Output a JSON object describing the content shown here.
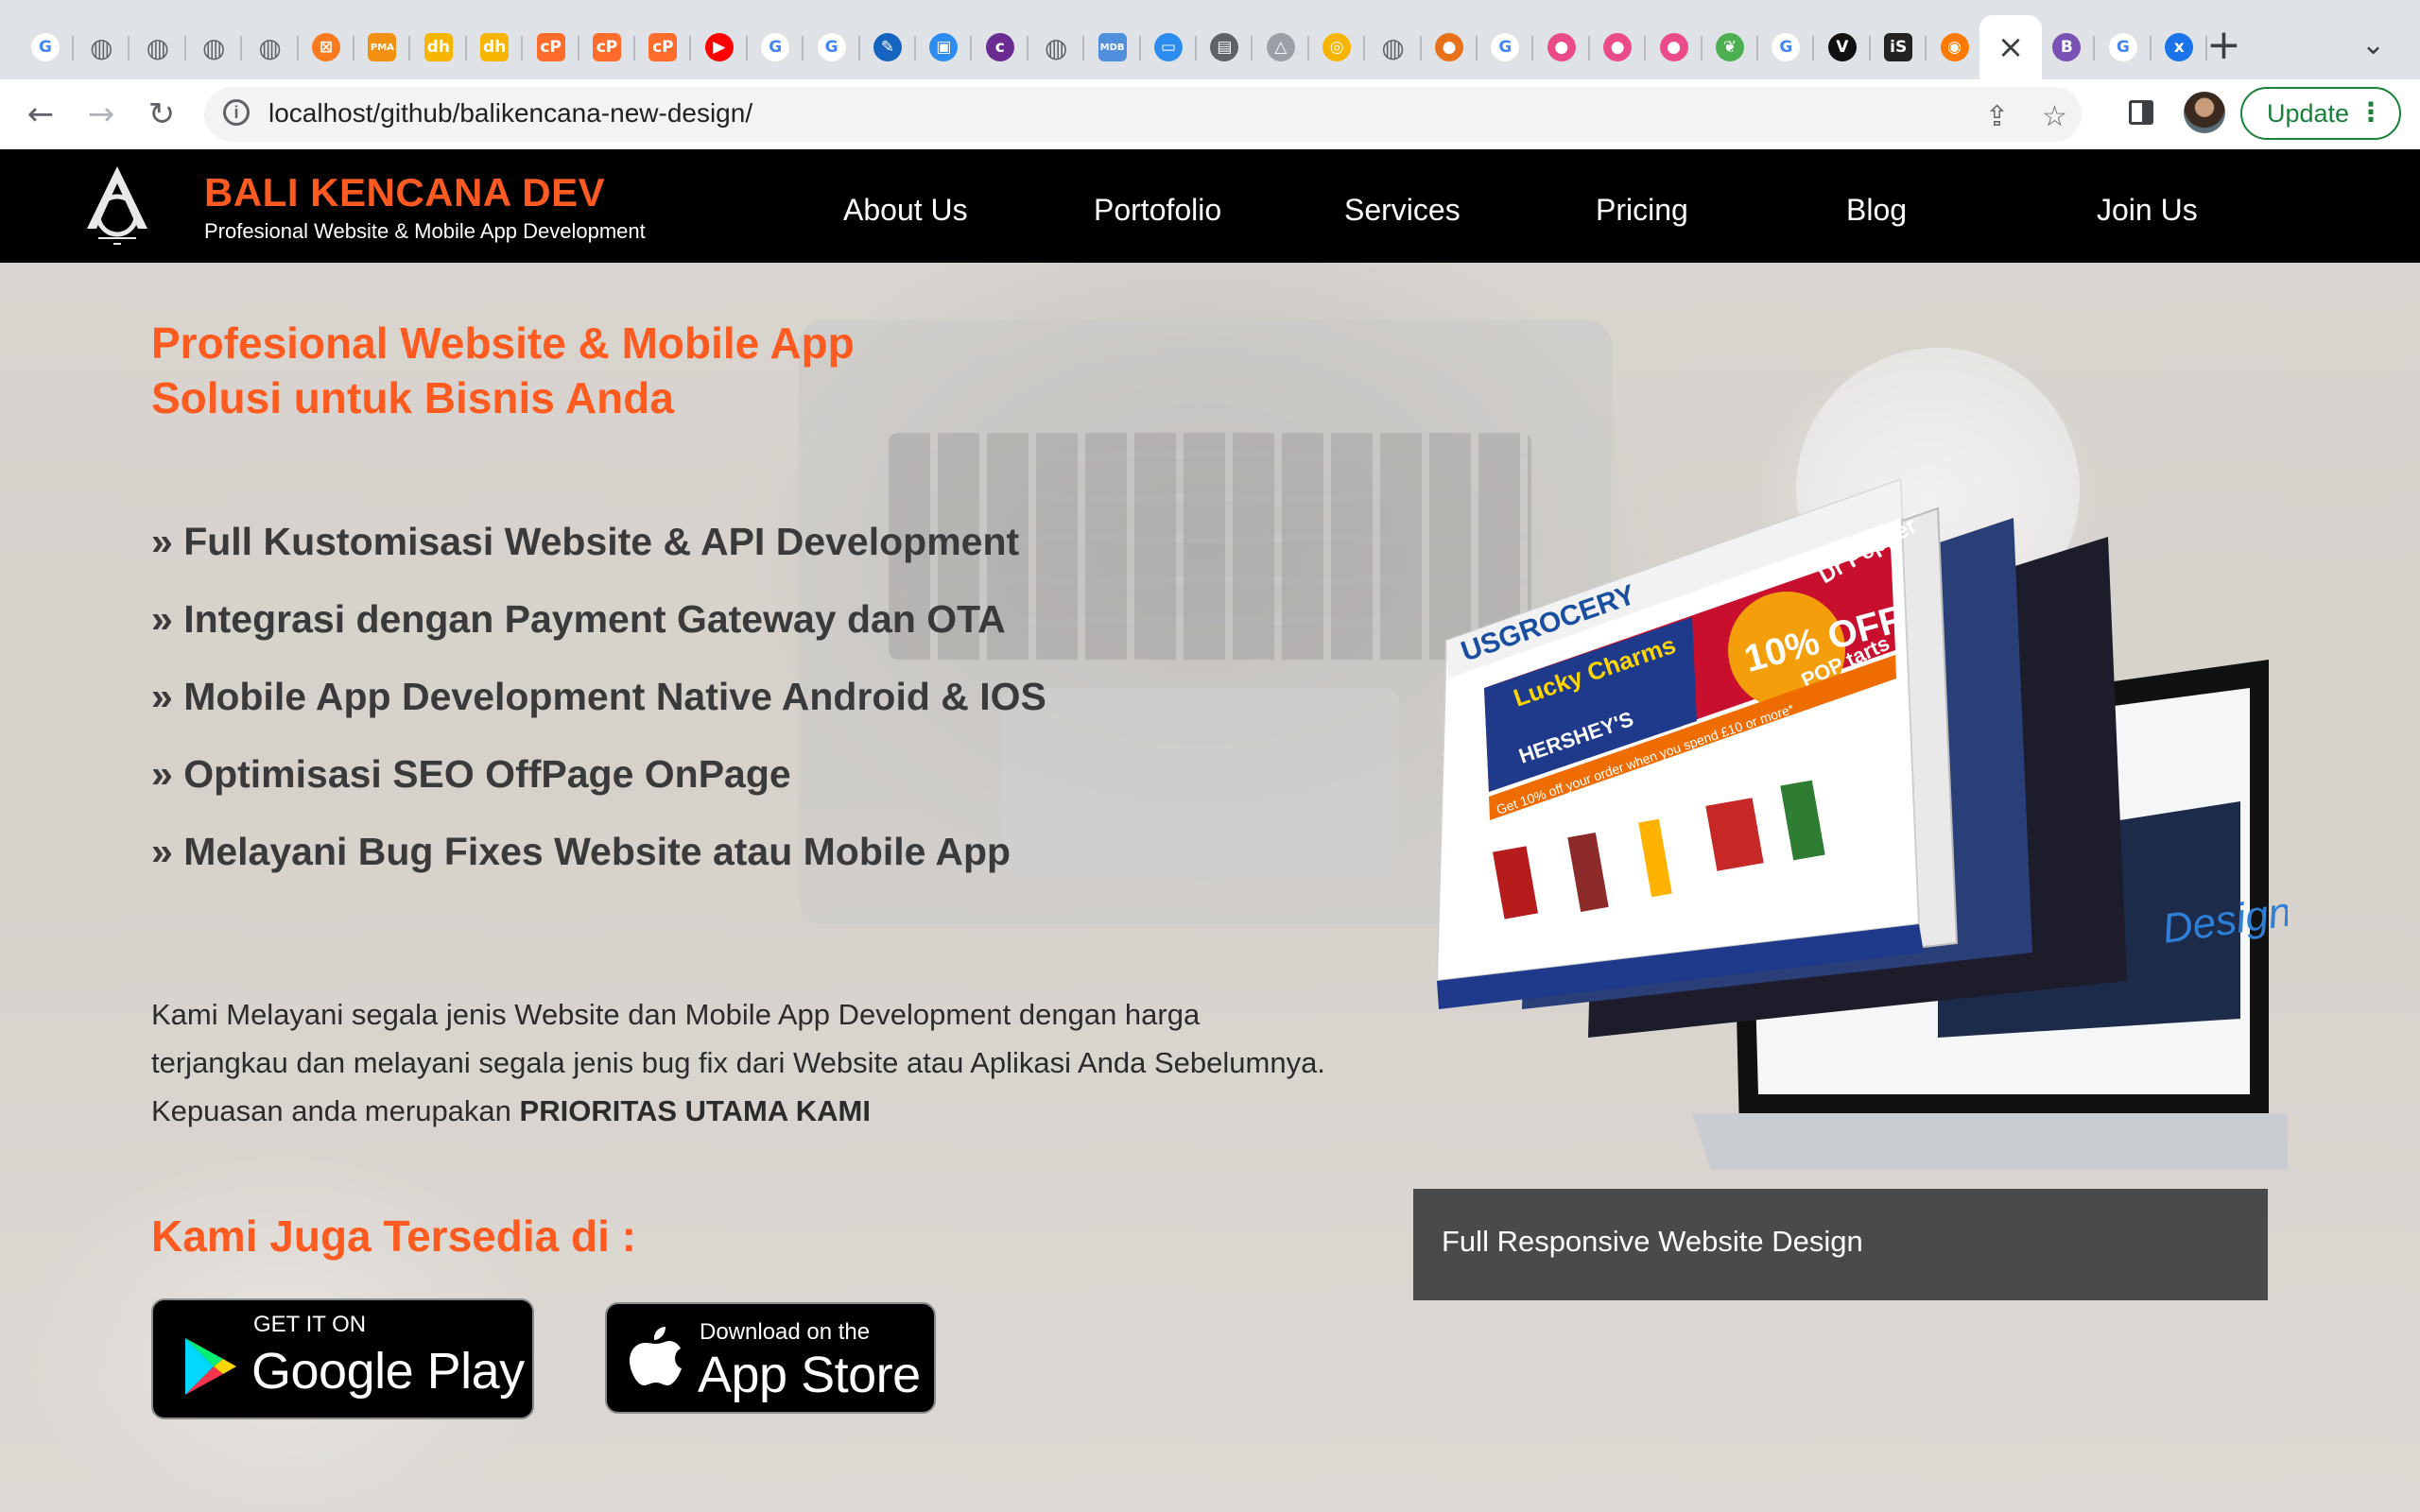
{
  "browser": {
    "tabs": [
      {
        "icon": "google-icon",
        "glyph": "G",
        "color": "#4285f4"
      },
      {
        "icon": "globe-icon",
        "glyph": "◍",
        "color": "#5f6368"
      },
      {
        "icon": "globe-icon",
        "glyph": "◍",
        "color": "#5f6368"
      },
      {
        "icon": "globe-icon",
        "glyph": "◍",
        "color": "#5f6368"
      },
      {
        "icon": "globe-icon",
        "glyph": "◍",
        "color": "#5f6368"
      },
      {
        "icon": "xampp-icon",
        "glyph": "⊠",
        "color": "#f97a1f"
      },
      {
        "icon": "phpmyadmin-icon",
        "glyph": "PMA",
        "color": "#f29111"
      },
      {
        "icon": "dh-icon",
        "glyph": "dh",
        "color": "#f7b500"
      },
      {
        "icon": "dh-icon",
        "glyph": "dh",
        "color": "#f7b500"
      },
      {
        "icon": "cpanel-icon",
        "glyph": "cP",
        "color": "#ff6c2c"
      },
      {
        "icon": "cpanel-icon",
        "glyph": "cP",
        "color": "#ff6c2c"
      },
      {
        "icon": "cpanel-icon",
        "glyph": "cP",
        "color": "#ff6c2c"
      },
      {
        "icon": "youtube-icon",
        "glyph": "▶",
        "color": "#ff0000"
      },
      {
        "icon": "google-icon",
        "glyph": "G",
        "color": "#4285f4"
      },
      {
        "icon": "google-icon",
        "glyph": "G",
        "color": "#4285f4"
      },
      {
        "icon": "site-icon",
        "glyph": "✎",
        "color": "#1565c0"
      },
      {
        "icon": "site-icon",
        "glyph": "▣",
        "color": "#2d8cf0"
      },
      {
        "icon": "colorlib-icon",
        "glyph": "c",
        "color": "#6a2c91"
      },
      {
        "icon": "globe-icon",
        "glyph": "◍",
        "color": "#5f6368"
      },
      {
        "icon": "mdb-icon",
        "glyph": "MDB",
        "color": "#4f8fdc"
      },
      {
        "icon": "site-icon",
        "glyph": "▭",
        "color": "#2d8cf0"
      },
      {
        "icon": "site-icon",
        "glyph": "▤",
        "color": "#5f6368"
      },
      {
        "icon": "site-icon",
        "glyph": "△",
        "color": "#9aa0a6"
      },
      {
        "icon": "site-icon",
        "glyph": "◎",
        "color": "#f7b500"
      },
      {
        "icon": "globe-icon",
        "glyph": "◍",
        "color": "#5f6368"
      },
      {
        "icon": "site-icon",
        "glyph": "●",
        "color": "#e8711a"
      },
      {
        "icon": "google-icon",
        "glyph": "G",
        "color": "#4285f4"
      },
      {
        "icon": "dribbble-icon",
        "glyph": "●",
        "color": "#ea4c89"
      },
      {
        "icon": "dribbble-icon",
        "glyph": "●",
        "color": "#ea4c89"
      },
      {
        "icon": "dribbble-icon",
        "glyph": "●",
        "color": "#ea4c89"
      },
      {
        "icon": "leaf-icon",
        "glyph": "❦",
        "color": "#4caf50"
      },
      {
        "icon": "google-icon",
        "glyph": "G",
        "color": "#4285f4"
      },
      {
        "icon": "vim-icon",
        "glyph": "V",
        "color": "#111111"
      },
      {
        "icon": "site-icon",
        "glyph": "iS",
        "color": "#222222"
      },
      {
        "icon": "site-icon",
        "glyph": "◉",
        "color": "#ff7a00"
      },
      {
        "icon": "close-icon",
        "glyph": "×",
        "color": "#3c4043",
        "active": true
      },
      {
        "icon": "bootstrap-icon",
        "glyph": "B",
        "color": "#7952b3"
      },
      {
        "icon": "google-icon",
        "glyph": "G",
        "color": "#4285f4"
      },
      {
        "icon": "site-icon",
        "glyph": "x",
        "color": "#1a73e8"
      }
    ],
    "url": "localhost/github/balikencana-new-design/",
    "update_label": "Update"
  },
  "site": {
    "brand_name": "BALI KENCANA DEV",
    "brand_tagline": "Profesional Website & Mobile App Development",
    "nav": [
      "About Us",
      "Portofolio",
      "Services",
      "Pricing",
      "Blog",
      "Join Us"
    ]
  },
  "hero": {
    "title_line1": "Profesional Website & Mobile App",
    "title_line2": "Solusi untuk Bisnis Anda",
    "features": [
      "» Full Kustomisasi Website & API Development",
      "» Integrasi dengan Payment Gateway dan OTA",
      "» Mobile App Development Native Android & IOS",
      "» Optimisasi SEO OffPage OnPage",
      "» Melayani Bug Fixes Website atau Mobile App"
    ],
    "desc_line1": "Kami Melayani segala jenis Website dan Mobile App Development dengan harga",
    "desc_line2": "terjangkau dan melayani segala jenis bug fix dari Website atau Aplikasi Anda Sebelumnya.",
    "desc_line3_prefix": "Kepuasan anda merupakan",
    "desc_line3_bold": "PRIORITAS UTAMA KAMI",
    "also_available": "Kami Juga Tersedia di :",
    "google_play": {
      "small": "GET IT ON",
      "big": "Google Play"
    },
    "app_store": {
      "small": "Download on the",
      "big": "App Store"
    },
    "mockup_caption": "Full Responsive Website Design",
    "mockup_screen": {
      "brand": "USGROCERY",
      "promo": "10% OFF",
      "banner": "Get 10% off your order when you spend £10 or more*",
      "products": [
        "Lucky Charms",
        "HERSHEY'S",
        "Dr Pepper",
        "POP tarts"
      ],
      "back_screen_text": "Design"
    }
  }
}
